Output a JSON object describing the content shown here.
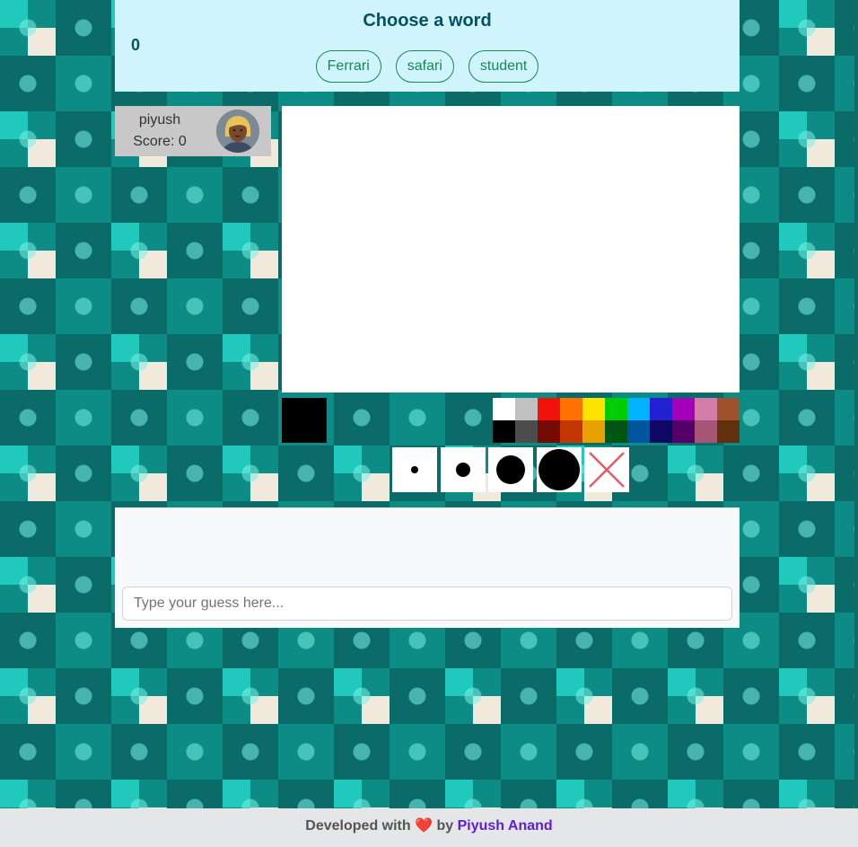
{
  "header": {
    "title": "Choose a word",
    "timer": "0",
    "word_choices": [
      "Ferrari",
      "safari",
      "student"
    ]
  },
  "player": {
    "name": "piyush",
    "score": "Score: 0"
  },
  "palette": {
    "current_color": "#000000",
    "colors_top": [
      "#ffffff",
      "#c1c1c1",
      "#ef130b",
      "#ff7100",
      "#ffe400",
      "#00cc00",
      "#00b2ff",
      "#231fd3",
      "#a300ba",
      "#d37caa",
      "#a0522d"
    ],
    "colors_bottom": [
      "#000000",
      "#4c4c4c",
      "#740b07",
      "#c23800",
      "#e8a200",
      "#005510",
      "#00569e",
      "#0e0865",
      "#550069",
      "#a75574",
      "#63300d"
    ]
  },
  "brushes": [
    "brush-size-1",
    "brush-size-2",
    "brush-size-3",
    "brush-size-4",
    "clear-icon"
  ],
  "chat": {
    "placeholder": "Type your guess here..."
  },
  "footer": {
    "prefix": "Developed with",
    "heart": "❤️",
    "by": "by",
    "author": "Piyush Anand"
  }
}
